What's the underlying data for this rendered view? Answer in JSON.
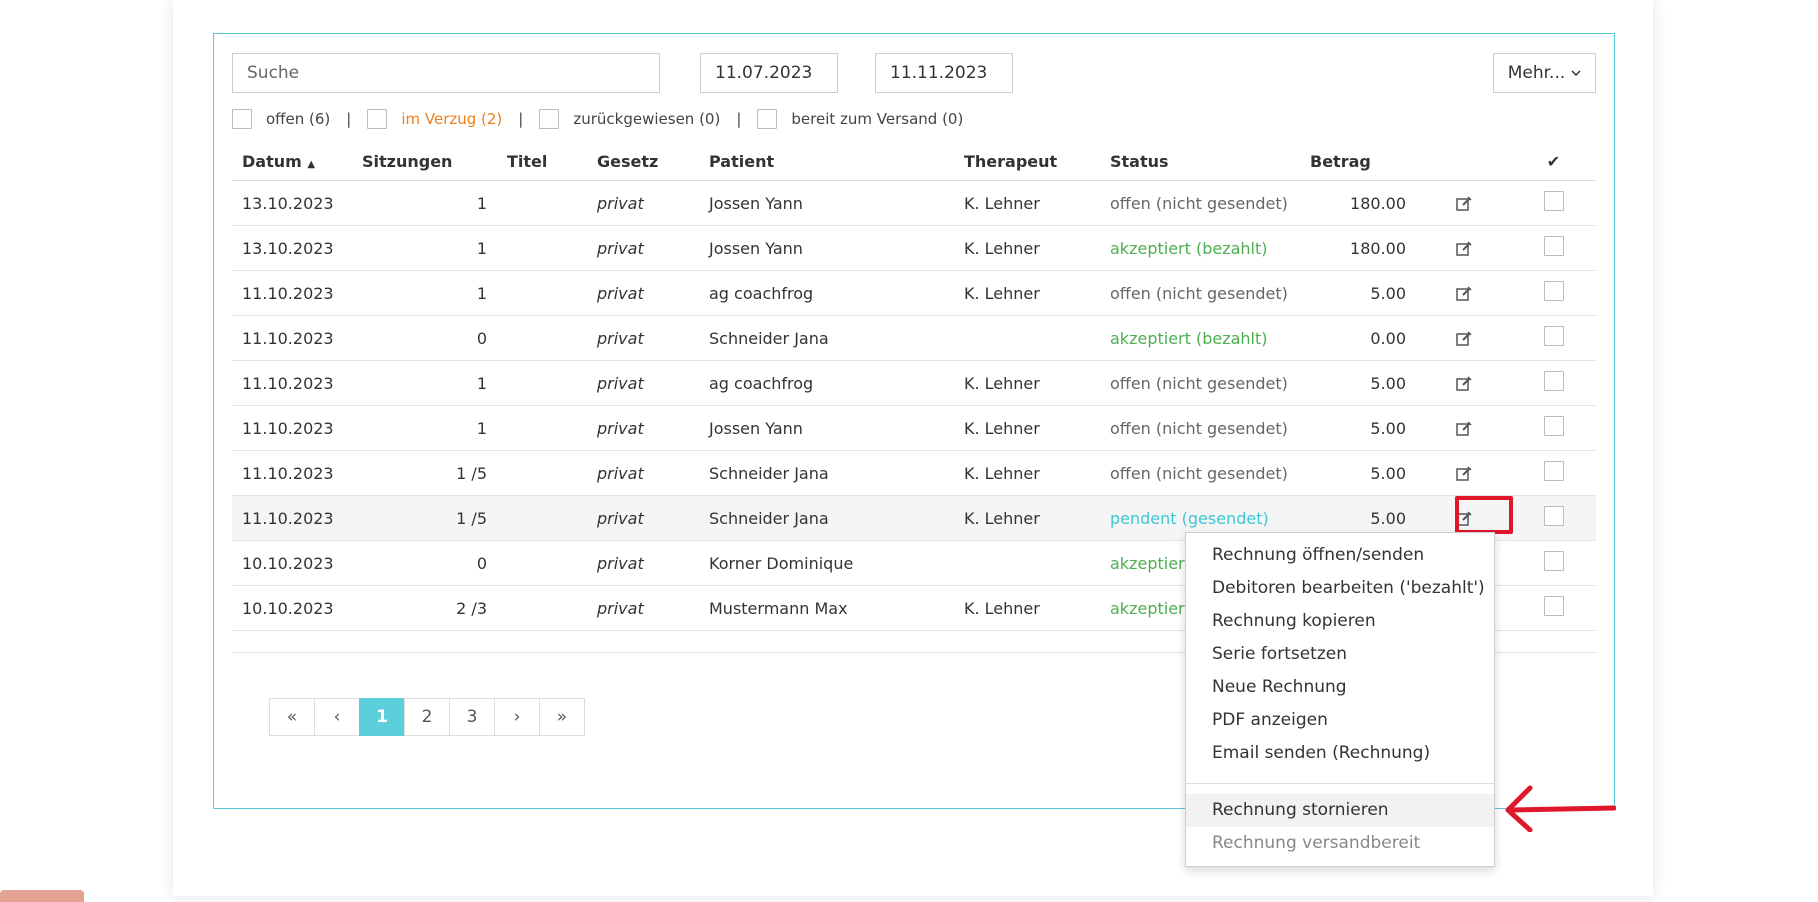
{
  "search": {
    "placeholder": "Suche"
  },
  "dates": {
    "from": "11.07.2023",
    "to": "11.11.2023"
  },
  "more_button": {
    "label": "Mehr..."
  },
  "filters": [
    {
      "label": "offen (6)"
    },
    {
      "label": "im Verzug (2)"
    },
    {
      "label": "zurückgewiesen (0)"
    },
    {
      "label": "bereit zum Versand (0)"
    }
  ],
  "table": {
    "headers": {
      "datum": "Datum",
      "sitzungen": "Sitzungen",
      "titel": "Titel",
      "gesetz": "Gesetz",
      "patient": "Patient",
      "therapeut": "Therapeut",
      "status": "Status",
      "betrag": "Betrag",
      "check": "✔"
    },
    "rows": [
      {
        "datum": "13.10.2023",
        "sitzungen": "1",
        "gesetz": "privat",
        "patient": "Jossen Yann",
        "therapeut": "K. Lehner",
        "status": "offen (nicht gesendet)",
        "betrag": "180.00"
      },
      {
        "datum": "13.10.2023",
        "sitzungen": "1",
        "gesetz": "privat",
        "patient": "Jossen Yann",
        "therapeut": "K. Lehner",
        "status": "akzeptiert (bezahlt)",
        "betrag": "180.00"
      },
      {
        "datum": "11.10.2023",
        "sitzungen": "1",
        "gesetz": "privat",
        "patient": "ag coachfrog",
        "therapeut": "K. Lehner",
        "status": "offen (nicht gesendet)",
        "betrag": "5.00"
      },
      {
        "datum": "11.10.2023",
        "sitzungen": "0",
        "gesetz": "privat",
        "patient": "Schneider Jana",
        "therapeut": "",
        "status": "akzeptiert (bezahlt)",
        "betrag": "0.00"
      },
      {
        "datum": "11.10.2023",
        "sitzungen": "1",
        "gesetz": "privat",
        "patient": "ag coachfrog",
        "therapeut": "K. Lehner",
        "status": "offen (nicht gesendet)",
        "betrag": "5.00"
      },
      {
        "datum": "11.10.2023",
        "sitzungen": "1",
        "gesetz": "privat",
        "patient": "Jossen Yann",
        "therapeut": "K. Lehner",
        "status": "offen (nicht gesendet)",
        "betrag": "5.00"
      },
      {
        "datum": "11.10.2023",
        "sitzungen": "1 /5",
        "gesetz": "privat",
        "patient": "Schneider Jana",
        "therapeut": "K. Lehner",
        "status": "offen (nicht gesendet)",
        "betrag": "5.00"
      },
      {
        "datum": "11.10.2023",
        "sitzungen": "1 /5",
        "gesetz": "privat",
        "patient": "Schneider Jana",
        "therapeut": "K. Lehner",
        "status": "pendent (gesendet)",
        "betrag": "5.00"
      },
      {
        "datum": "10.10.2023",
        "sitzungen": "0",
        "gesetz": "privat",
        "patient": "Korner Dominique",
        "therapeut": "",
        "status": "akzeptiert",
        "betrag": ""
      },
      {
        "datum": "10.10.2023",
        "sitzungen": "2 /3",
        "gesetz": "privat",
        "patient": "Mustermann Max",
        "therapeut": "K. Lehner",
        "status": "akzeptiert",
        "betrag": ""
      }
    ]
  },
  "pagination": [
    "«",
    "‹",
    "1",
    "2",
    "3",
    "›",
    "»"
  ],
  "context_menu": {
    "items": [
      "Rechnung öffnen/senden",
      "Debitoren bearbeiten ('bezahlt')",
      "Rechnung kopieren",
      "Serie fortsetzen",
      "Neue Rechnung",
      "PDF anzeigen",
      "Email senden (Rechnung)"
    ],
    "items_after_divider": [
      "Rechnung stornieren",
      "Rechnung versandbereit"
    ]
  },
  "colors": {
    "accent": "#5bd0dc",
    "overdue": "#e8801e",
    "accepted": "#4caf50",
    "pending": "#3cc7d4",
    "annotation": "#e0162b"
  },
  "icons": {
    "row_action": "edit-icon",
    "sort": "sort-asc-icon",
    "more": "chevron-down-icon"
  }
}
